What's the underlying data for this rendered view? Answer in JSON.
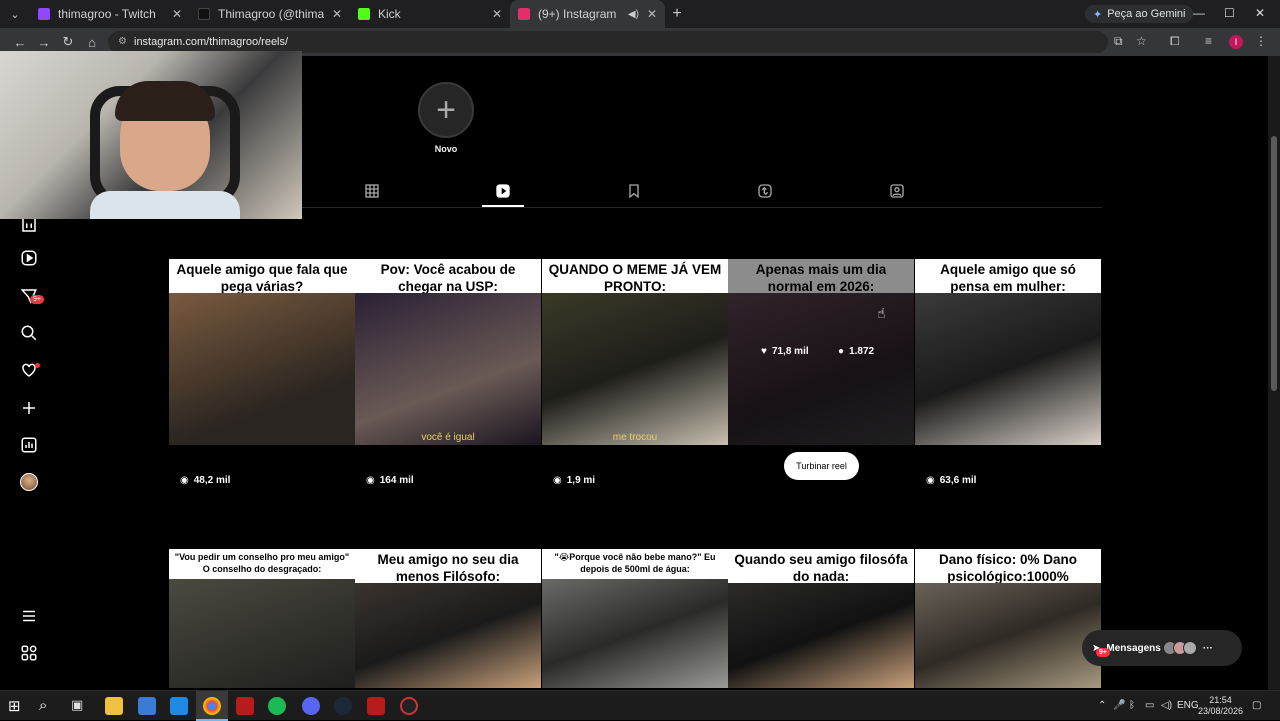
{
  "browser": {
    "tabs": [
      {
        "title": "thimagroo - Twitch",
        "color": "#9146ff"
      },
      {
        "title": "Thimagroo (@thimagroo) | TikT",
        "color": "#111111"
      },
      {
        "title": "Kick",
        "color": "#53fc18"
      },
      {
        "title": "(9+) Instagram",
        "color": "#e1306c"
      }
    ],
    "gemini_label": "Peça ao Gemini",
    "url": "instagram.com/thimagroo/reels/",
    "profile_initial": "I"
  },
  "profile": {
    "new_label": "Novo",
    "tabs": [
      "grid-icon",
      "reels-icon",
      "saved-icon",
      "reposts-icon",
      "tagged-icon"
    ]
  },
  "reels": [
    {
      "caption": "Aquele amigo que fala que pega várias?",
      "views": "48,2 mil",
      "subtitle": "",
      "bg": "#5a4a3e"
    },
    {
      "caption": "Pov: Você acabou de chegar na USP:",
      "views": "164 mil",
      "subtitle": "você é igual",
      "bg": "#2a2035"
    },
    {
      "caption": "QUANDO O MEME JÁ VEM PRONTO:",
      "views": "1,9 mi",
      "subtitle": "me trocou",
      "bg": "#2e3326"
    },
    {
      "caption": "Apenas mais um dia normal em 2026:",
      "likes": "71,8 mil",
      "comments": "1.872",
      "subtitle": "",
      "bg": "#3a3036"
    },
    {
      "caption": "Aquele amigo que só pensa em mulher:",
      "views": "63,6 mil",
      "subtitle": "",
      "bg": "#4a4548"
    },
    {
      "caption": "\"Vou pedir um conselho pro meu amigo\" O conselho do desgraçado:",
      "subtitle": "",
      "bg": "#3b3a35"
    },
    {
      "caption": "Meu amigo no seu dia menos Filósofo:",
      "subtitle": "",
      "bg": "#2f2a28"
    },
    {
      "caption": "\"😭Porque você não bebe mano?\" Eu depois de 500ml de água:",
      "subtitle": "",
      "bg": "#4c4a46"
    },
    {
      "caption": "Quando seu amigo filosófa do nada:",
      "subtitle": "",
      "bg": "#2c2b2a"
    },
    {
      "caption": "Dano físico: 0% Dano psicológico:1000%",
      "subtitle": "",
      "bg": "#4e4a42"
    }
  ],
  "boost_label": "Turbinar reel",
  "messages": {
    "label": "Mensagens",
    "badge": "9+"
  },
  "sidebar": {
    "notif_badge": "9+"
  },
  "taskbar": {
    "lang": "ENG",
    "time": "21:54",
    "date": "23/08/2026"
  }
}
